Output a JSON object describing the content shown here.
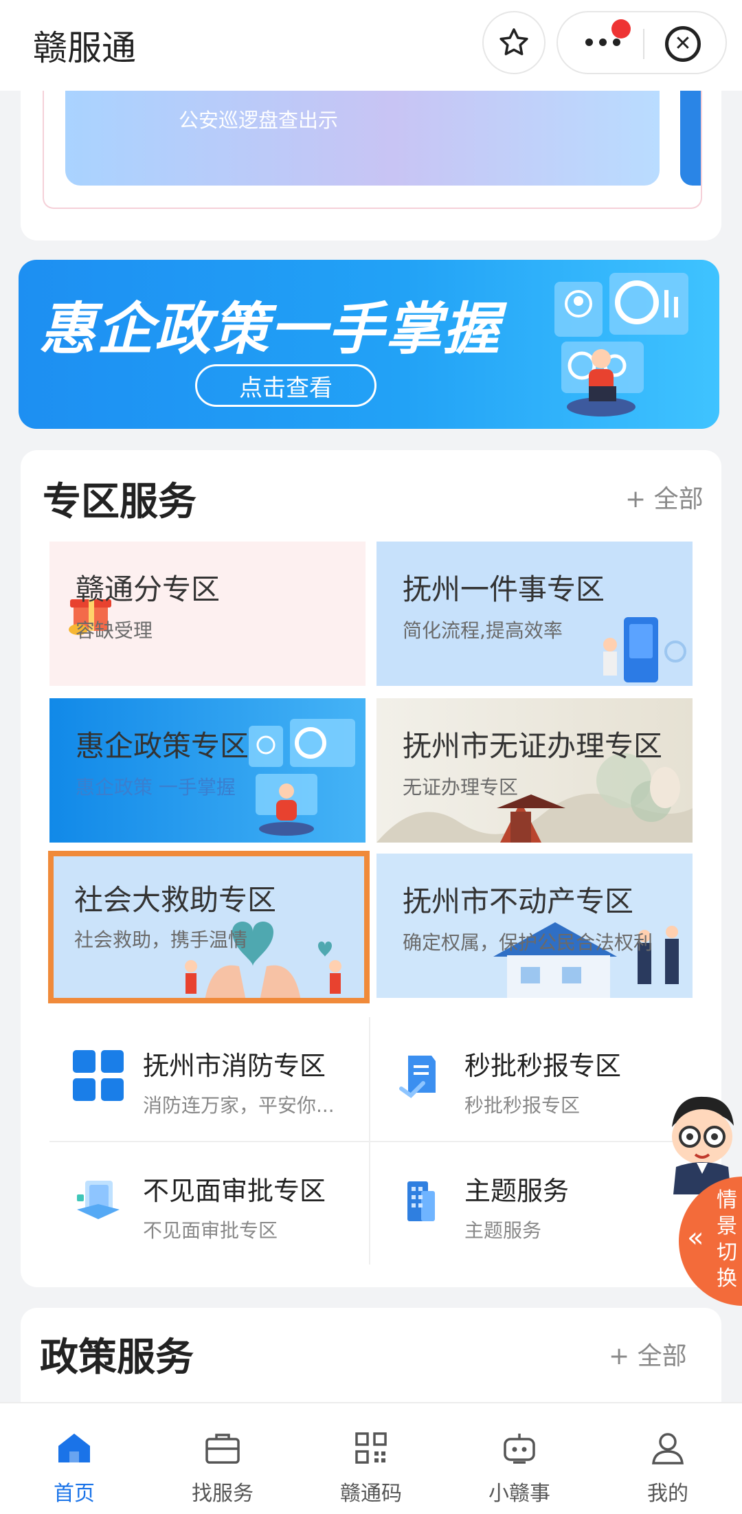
{
  "header": {
    "title": "赣服通"
  },
  "top_banner": {
    "text": "公安巡逻盘查出示"
  },
  "promo": {
    "title": "惠企政策一手掌握",
    "button": "点击查看"
  },
  "zone": {
    "title": "专区服务",
    "more": "+ 全部",
    "tiles": [
      {
        "title": "赣通分专区",
        "sub": "容缺受理"
      },
      {
        "title": "抚州一件事专区",
        "sub": "简化流程,提高效率"
      },
      {
        "title": "惠企政策专区",
        "sub": "惠企政策 一手掌握"
      },
      {
        "title": "抚州市无证办理专区",
        "sub": "无证办理专区"
      },
      {
        "title": "社会大救助专区",
        "sub": "社会救助，携手温情"
      },
      {
        "title": "抚州市不动产专区",
        "sub": "确定权属，保护公民合法权利"
      }
    ],
    "list": [
      {
        "title": "抚州市消防专区",
        "sub": "消防连万家，平安你..."
      },
      {
        "title": "秒批秒报专区",
        "sub": "秒批秒报专区"
      },
      {
        "title": "不见面审批专区",
        "sub": "不见面审批专区"
      },
      {
        "title": "主题服务",
        "sub": "主题服务"
      }
    ]
  },
  "policy": {
    "title": "政策服务",
    "more": "+ 全部"
  },
  "float": {
    "text": "情景切换"
  },
  "nav": [
    {
      "label": "首页",
      "icon": "home-icon",
      "active": true
    },
    {
      "label": "找服务",
      "icon": "briefcase-icon",
      "active": false
    },
    {
      "label": "赣通码",
      "icon": "qr-code-icon",
      "active": false
    },
    {
      "label": "小赣事",
      "icon": "robot-icon",
      "active": false
    },
    {
      "label": "我的",
      "icon": "user-icon",
      "active": false
    }
  ],
  "colors": {
    "accent": "#1a73e8",
    "highlight_border": "#f08a3a",
    "float_tab": "#f36b3a"
  }
}
